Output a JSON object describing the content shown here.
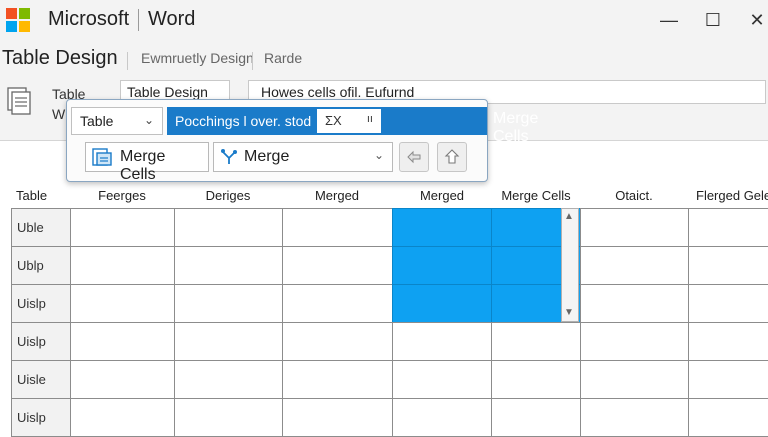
{
  "window": {
    "brand": "Microsoft",
    "app": "Word",
    "minimize_glyph": "—",
    "maximize_glyph": "☐",
    "close_glyph": "✕"
  },
  "ribbon_tabs": [
    "Table Design",
    "Ewmruetly Design",
    "Rarde"
  ],
  "ribbon": {
    "table_label_line1": "Table",
    "table_label_line2": "W",
    "style_box": "Table Design",
    "formula_box": "Howes cells ofil. Eufurnd"
  },
  "panel": {
    "select_value": "Table",
    "topbar_text": "Pocchings l over. stod",
    "fx_text": "ΣΧ",
    "fx_extra": "ıı",
    "merge_cells_header": "Merge Cells",
    "merge_cells_button": "Merge Cells",
    "merge_dropdown": "Merge"
  },
  "grid": {
    "headers": [
      "Table",
      "Feerges",
      "Deriges",
      "Merged",
      "Merged",
      "Merge Cells",
      "Otaict.",
      "Flerged Gelen"
    ],
    "row_labels": [
      "Uble",
      "Ublp",
      "Uislp",
      "Uislp",
      "Uisle",
      "Uislp"
    ],
    "selection": {
      "rows": [
        0,
        1,
        2
      ],
      "cols": [
        4,
        5
      ]
    }
  },
  "colors": {
    "accent": "#1a7bc9",
    "selection": "#0ea1f2"
  },
  "icons": {
    "logo": "microsoft-logo",
    "document": "document-icon",
    "merge_cells": "merge-cells-icon",
    "merge": "merge-icon",
    "undo": "undo-icon",
    "redo": "redo-icon"
  }
}
